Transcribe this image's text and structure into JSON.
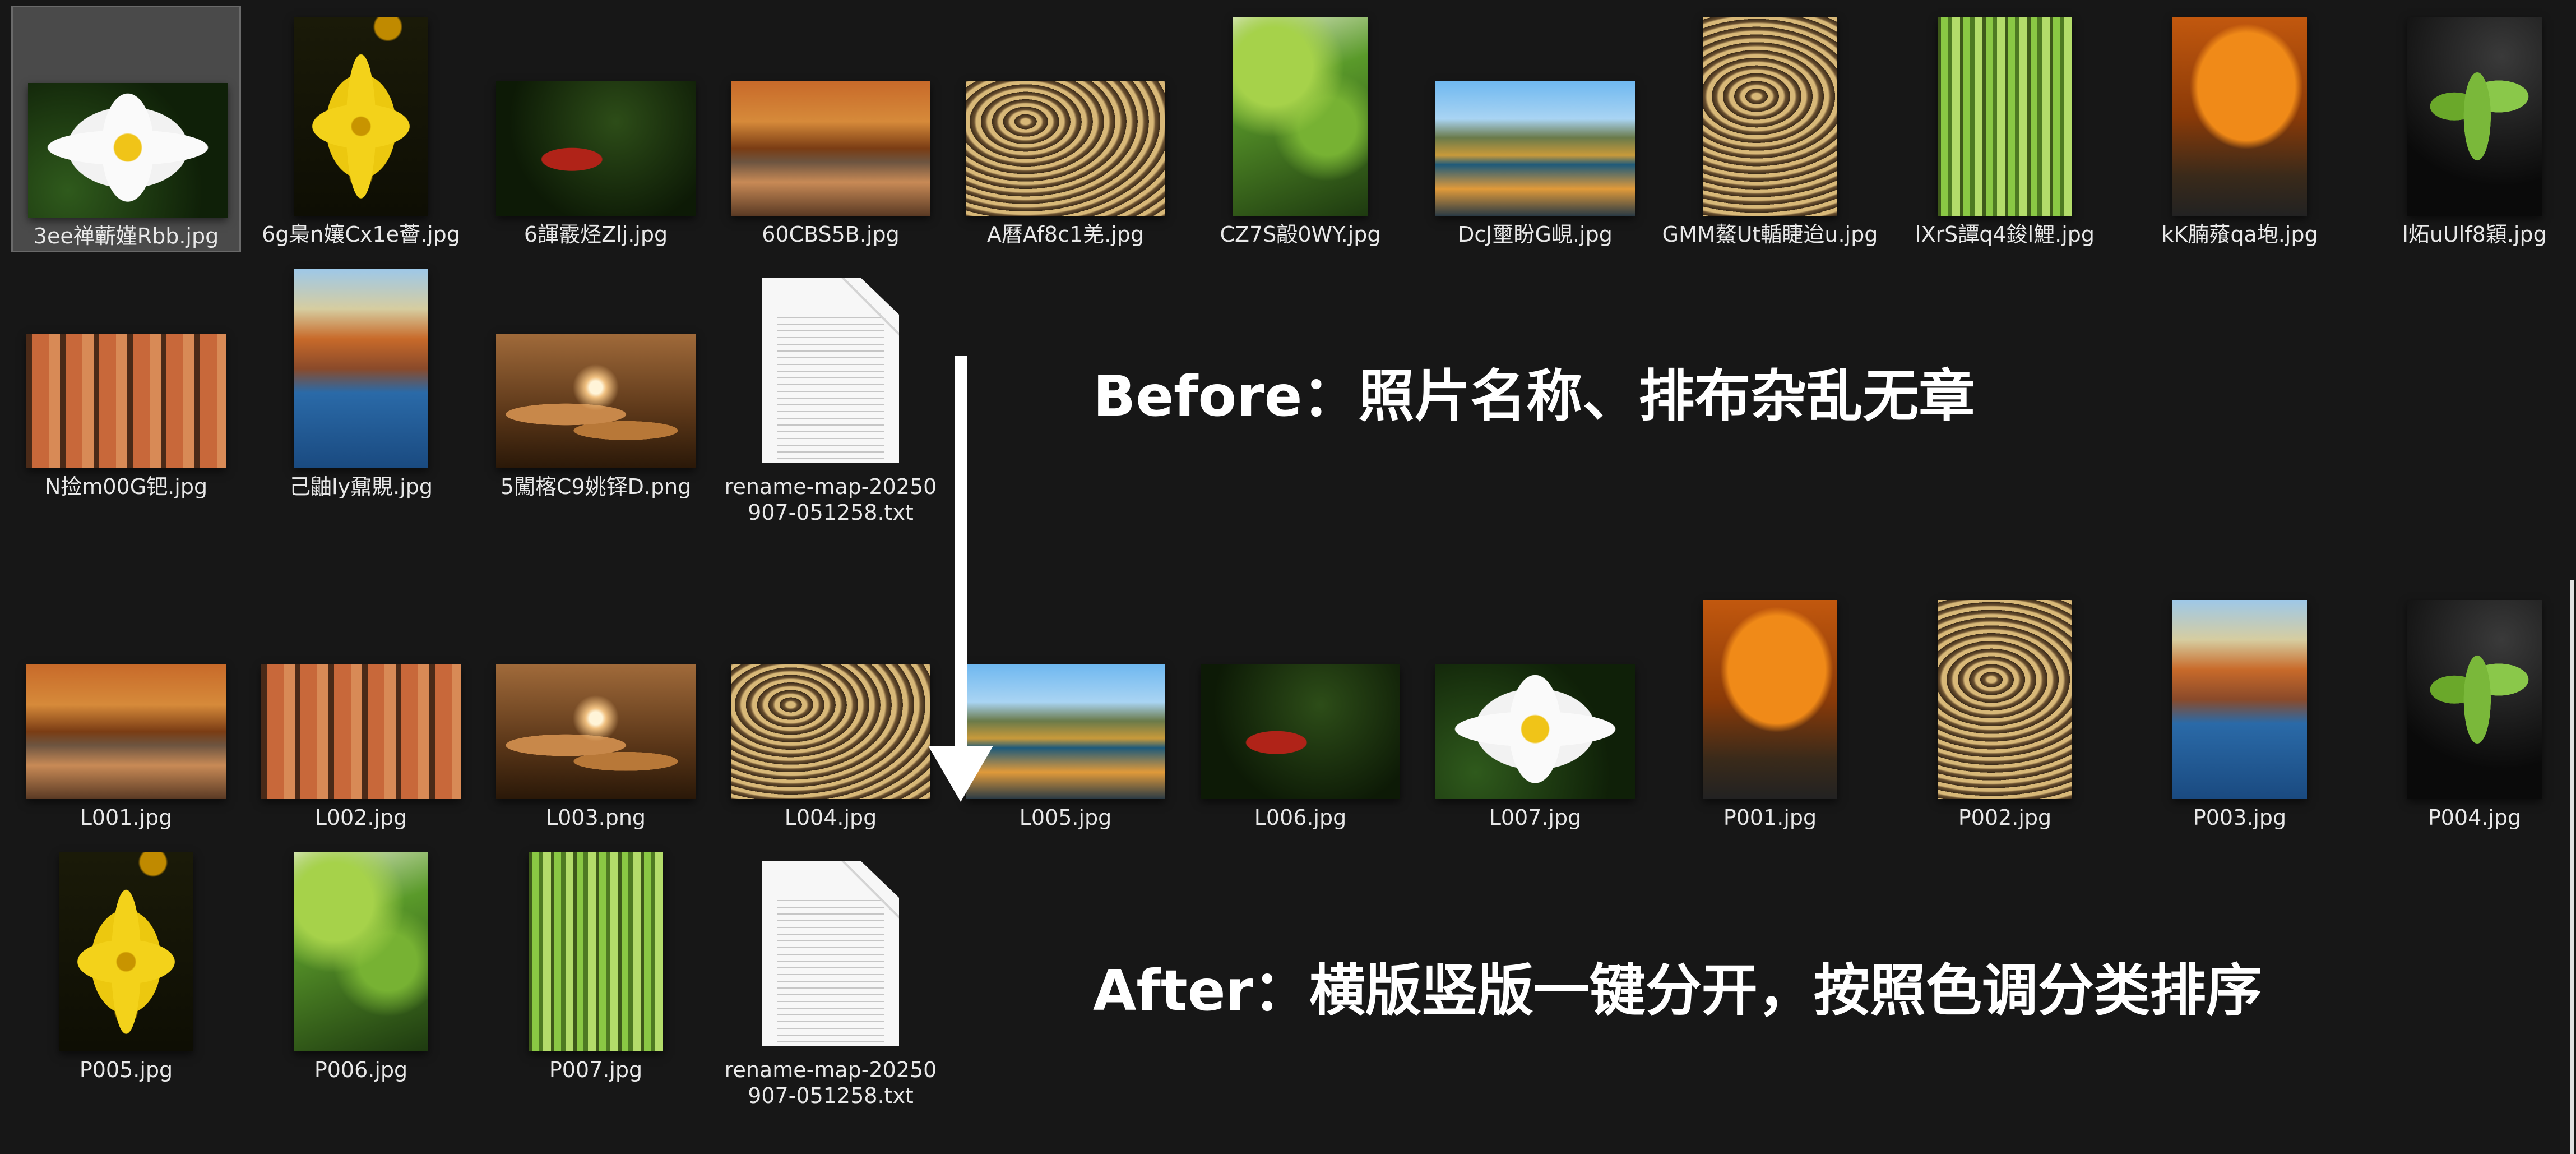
{
  "before_files": [
    {
      "name": "3ee禅蘄嫤Rbb.jpg",
      "kind": "landscape",
      "photo": "daisy",
      "selected": true
    },
    {
      "name": "6g梟n孃Cx1e薈.jpg",
      "kind": "portrait",
      "photo": "yflower"
    },
    {
      "name": "6諢霰烃Zlj.jpg",
      "kind": "landscape",
      "photo": "pavilion"
    },
    {
      "name": "60CBS5B.jpg",
      "kind": "landscape",
      "photo": "autumnwater"
    },
    {
      "name": "A曆Af8c1羌.jpg",
      "kind": "landscape",
      "photo": "ripple"
    },
    {
      "name": "CZ7S毃0WY.jpg",
      "kind": "portrait",
      "photo": "maple"
    },
    {
      "name": "DcJ壐盼G峴.jpg",
      "kind": "landscape",
      "photo": "lakehouse"
    },
    {
      "name": "GMM鰲Ut輴睫迨u.jpg",
      "kind": "portrait",
      "photo": "ripplev"
    },
    {
      "name": "lXrS譚q4鋑l鯉.jpg",
      "kind": "portrait",
      "photo": "forest"
    },
    {
      "name": "kK腩薞qa垉.jpg",
      "kind": "portrait",
      "photo": "orangetree"
    },
    {
      "name": "l炻uUlf8穎.jpg",
      "kind": "portrait",
      "photo": "plant"
    },
    {
      "name": "N捡m00G钯.jpg",
      "kind": "landscape",
      "photo": "swamp"
    },
    {
      "name": "己鼬ly鼐覞.jpg",
      "kind": "portrait",
      "photo": "castle"
    },
    {
      "name": "5闖楁C9姚铎D.png",
      "kind": "landscape",
      "photo": "sunset"
    },
    {
      "name": "rename-map-20250907-051258.txt",
      "kind": "doc",
      "photo": "doc"
    }
  ],
  "after_files": [
    {
      "name": "L001.jpg",
      "kind": "landscape",
      "photo": "autumnwater"
    },
    {
      "name": "L002.jpg",
      "kind": "landscape",
      "photo": "swamp"
    },
    {
      "name": "L003.png",
      "kind": "landscape",
      "photo": "sunset"
    },
    {
      "name": "L004.jpg",
      "kind": "landscape",
      "photo": "ripple"
    },
    {
      "name": "L005.jpg",
      "kind": "landscape",
      "photo": "lakehouse"
    },
    {
      "name": "L006.jpg",
      "kind": "landscape",
      "photo": "pavilion"
    },
    {
      "name": "L007.jpg",
      "kind": "landscape",
      "photo": "daisy"
    },
    {
      "name": "P001.jpg",
      "kind": "portrait",
      "photo": "orangetree"
    },
    {
      "name": "P002.jpg",
      "kind": "portrait",
      "photo": "ripplev"
    },
    {
      "name": "P003.jpg",
      "kind": "portrait",
      "photo": "castle"
    },
    {
      "name": "P004.jpg",
      "kind": "portrait",
      "photo": "plant"
    },
    {
      "name": "P005.jpg",
      "kind": "portrait",
      "photo": "yflower"
    },
    {
      "name": "P006.jpg",
      "kind": "portrait",
      "photo": "maple"
    },
    {
      "name": "P007.jpg",
      "kind": "portrait",
      "photo": "forest"
    },
    {
      "name": "rename-map-20250907-051258.txt",
      "kind": "doc",
      "photo": "doc"
    }
  ],
  "captions": {
    "before": "Before：照片名称、排布杂乱无章",
    "after": "After：横版竖版一键分开，按照色调分类排序"
  },
  "colors": {
    "background": "#171717",
    "selected_tile": "#4a4a4a",
    "text": "#e8e8e8",
    "caption": "#ffffff"
  }
}
